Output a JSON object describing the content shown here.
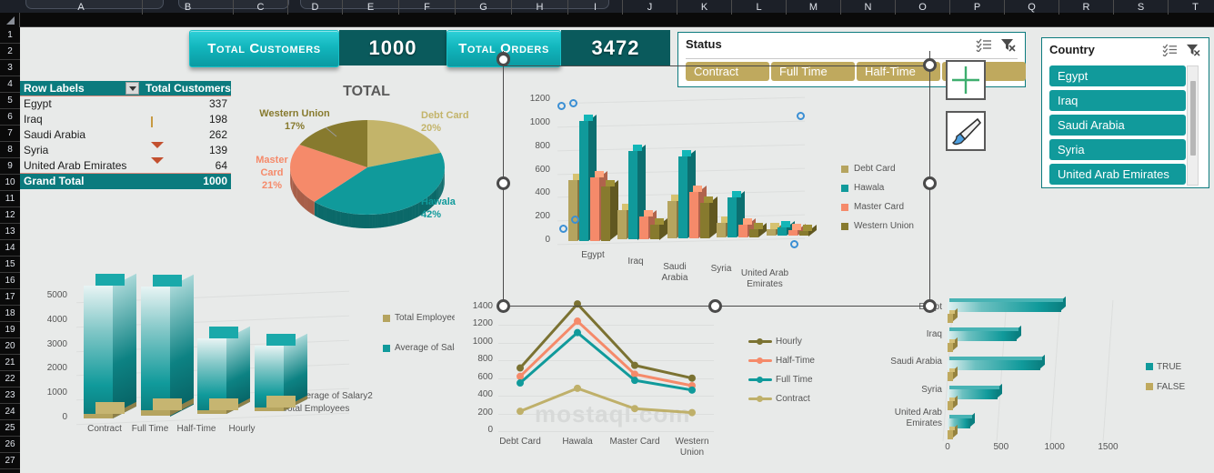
{
  "app": {
    "columns": [
      "A",
      "B",
      "C",
      "D",
      "E",
      "F",
      "G",
      "H",
      "I",
      "J",
      "K",
      "L",
      "M",
      "N",
      "O",
      "P",
      "Q",
      "R",
      "S",
      "T"
    ],
    "rows": [
      1,
      2,
      3,
      4,
      5,
      6,
      7,
      8,
      9,
      10,
      11,
      12,
      13,
      14,
      15,
      16,
      17,
      18,
      19,
      20,
      21,
      22,
      23,
      24,
      25,
      26,
      27
    ]
  },
  "kpis": [
    {
      "label": "Total Customers",
      "value": "1000"
    },
    {
      "label": "Total Orders",
      "value": "3472"
    }
  ],
  "pivot": {
    "header": {
      "label": "Row Labels",
      "value": "Total Customers"
    },
    "rows": [
      {
        "label": "Egypt",
        "value": "337",
        "icon": "arrow-up-icon"
      },
      {
        "label": "Iraq",
        "value": "198",
        "icon": "arrow-flat-icon"
      },
      {
        "label": "Saudi Arabia",
        "value": "262",
        "icon": "arrow-up-icon"
      },
      {
        "label": "Syria",
        "value": "139",
        "icon": "arrow-down-icon"
      },
      {
        "label": "United Arab Emirates",
        "value": "64",
        "icon": "arrow-down-icon"
      }
    ],
    "total": {
      "label": "Grand Total",
      "value": "1000"
    }
  },
  "slicers": {
    "status": {
      "title": "Status",
      "items": [
        "Contract",
        "Full Time",
        "Half-Time",
        ""
      ]
    },
    "country": {
      "title": "Country",
      "items": [
        "Egypt",
        "Iraq",
        "Saudi Arabia",
        "Syria",
        "United Arab Emirates"
      ]
    }
  },
  "cursors": {
    "crosshair": "crosshair-icon",
    "brush": "paintbrush-icon"
  },
  "watermark": "mostaql.com",
  "chart_data": [
    {
      "id": "pie-total",
      "type": "pie",
      "title": "TOTAL",
      "categories": [
        "Debt Card",
        "Hawala",
        "Master Card",
        "Western Union"
      ],
      "values": [
        20,
        42,
        21,
        17
      ],
      "labels": [
        "20%",
        "42%",
        "21%",
        "17%"
      ],
      "colors": [
        "#c3b46a",
        "#109a9b",
        "#f58a6a",
        "#877a2e"
      ],
      "legend": "none"
    },
    {
      "id": "orders-by-country-3d",
      "type": "bar",
      "title": "",
      "categories": [
        "Egypt",
        "Iraq",
        "Saudi Arabia",
        "Syria",
        "United Arab Emirates"
      ],
      "series": [
        {
          "name": "Debt Card",
          "values": [
            520,
            250,
            320,
            120,
            55
          ],
          "color": "#b5a45f"
        },
        {
          "name": "Hawala",
          "values": [
            1020,
            755,
            700,
            340,
            70
          ],
          "color": "#109a9b"
        },
        {
          "name": "Master Card",
          "values": [
            540,
            195,
            395,
            105,
            50
          ],
          "color": "#f58a6a"
        },
        {
          "name": "Western Union",
          "values": [
            460,
            130,
            300,
            70,
            45
          ],
          "color": "#877a2e"
        }
      ],
      "ylim": [
        0,
        1200
      ],
      "yticks": [
        0,
        200,
        400,
        600,
        800,
        1000,
        1200
      ],
      "ylabel": "",
      "xlabel": "",
      "grid": true,
      "legend": "right"
    },
    {
      "id": "salary-by-status-3d",
      "type": "bar",
      "title": "",
      "categories": [
        "Contract",
        "Full Time",
        "Half-Time",
        "Hourly"
      ],
      "series": [
        {
          "name": "Total Employees",
          "values": [
            180,
            220,
            150,
            165
          ],
          "color": "#b5a45f"
        },
        {
          "name": "Average of Salary2",
          "values": [
            5450,
            5320,
            3100,
            2700
          ],
          "color": "#109a9b"
        }
      ],
      "depth_labels": [
        "Average of Salary2",
        "Total Employees"
      ],
      "ylim": [
        0,
        5600
      ],
      "yticks": [
        0,
        1000,
        2000,
        3000,
        4000,
        5000
      ],
      "grid": true,
      "legend": "right"
    },
    {
      "id": "method-by-status-line",
      "type": "line",
      "title": "",
      "categories": [
        "Debt Card",
        "Hawala",
        "Master Card",
        "Western Union"
      ],
      "series": [
        {
          "name": "Hourly",
          "values": [
            715,
            1440,
            745,
            600
          ],
          "color": "#7b7232"
        },
        {
          "name": "Half-Time",
          "values": [
            620,
            1245,
            645,
            515
          ],
          "color": "#f58a6a"
        },
        {
          "name": "Full Time",
          "values": [
            545,
            1115,
            575,
            465
          ],
          "color": "#109a9b"
        },
        {
          "name": "Contract",
          "values": [
            225,
            485,
            255,
            210
          ],
          "color": "#bfb06a"
        }
      ],
      "ylim": [
        0,
        1400
      ],
      "yticks": [
        0,
        200,
        400,
        600,
        800,
        1000,
        1200,
        1400
      ],
      "grid": true,
      "legend": "right"
    },
    {
      "id": "country-truefalse-bar",
      "type": "bar",
      "orientation": "horizontal",
      "title": "",
      "categories": [
        "Egypt",
        "Iraq",
        "Saudi Arabia",
        "Syria",
        "United Arab Emirates"
      ],
      "series": [
        {
          "name": "TRUE",
          "values": [
            1065,
            645,
            870,
            470,
            215
          ],
          "color": "#109a9b"
        },
        {
          "name": "FALSE",
          "values": [
            30,
            28,
            32,
            22,
            18
          ],
          "color": "#bfa95e"
        }
      ],
      "xlim": [
        0,
        1700
      ],
      "xticks": [
        0,
        500,
        1000,
        1500
      ],
      "grid": true,
      "legend": "right"
    }
  ]
}
